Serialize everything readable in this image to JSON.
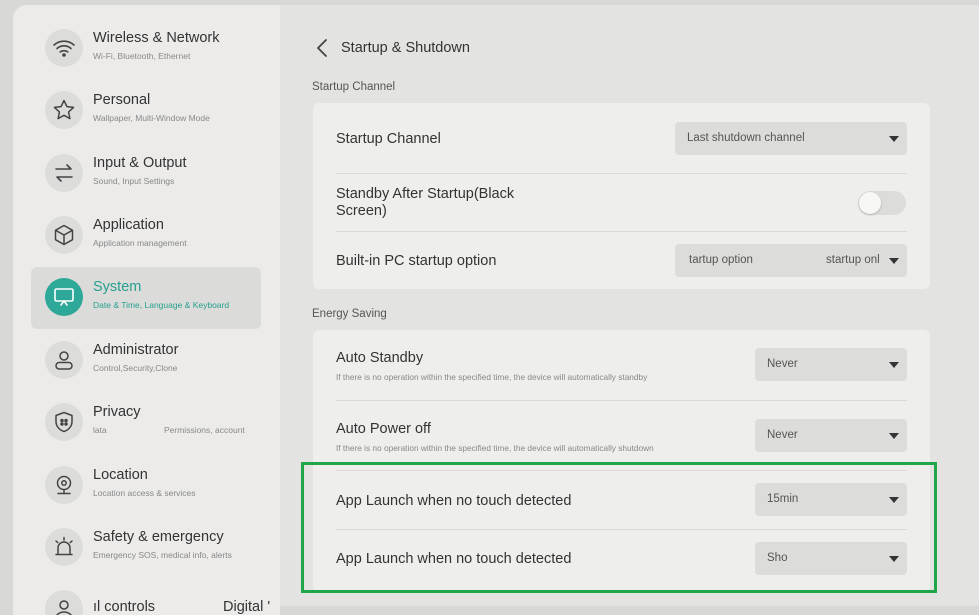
{
  "sidebar": {
    "items": [
      {
        "title": "Wireless & Network",
        "subtitle": "Wi-Fi, Bluetooth, Ethernet",
        "icon": "wifi-icon"
      },
      {
        "title": "Personal",
        "subtitle": "Wallpaper, Multi-Window Mode",
        "icon": "star-icon"
      },
      {
        "title": "Input & Output",
        "subtitle": "Sound, Input Settings",
        "icon": "arrows-icon"
      },
      {
        "title": "Application",
        "subtitle": "Application management",
        "icon": "cube-icon"
      },
      {
        "title": "System",
        "subtitle": "Date & Time, Language & Keyboard",
        "icon": "monitor-icon",
        "active": true
      },
      {
        "title": "Administrator",
        "subtitle": "Control,Security,Clone",
        "icon": "user-icon"
      },
      {
        "title": "Privacy",
        "subtitle": "lata",
        "subtitle_right": "Permissions, account",
        "icon": "shield-icon"
      },
      {
        "title": "Location",
        "subtitle": "Location access & services",
        "icon": "location-icon"
      },
      {
        "title": "Safety & emergency",
        "subtitle": "Emergency SOS, medical info, alerts",
        "icon": "alarm-icon"
      },
      {
        "title": "ıl controls",
        "title_right": "Digital '",
        "icon": "person-icon"
      }
    ]
  },
  "header": {
    "title": "Startup & Shutdown"
  },
  "sections": {
    "startup": {
      "label": "Startup Channel",
      "rows": {
        "channel": {
          "title": "Startup Channel",
          "value": "Last shutdown channel"
        },
        "standby": {
          "title": "Standby After Startup(Black Screen)",
          "toggle_on": false
        },
        "pc": {
          "title": "Built-in PC startup option",
          "value_left": "tartup option",
          "value_right": "startup onl"
        }
      }
    },
    "energy": {
      "label": "Energy Saving",
      "rows": {
        "auto_standby": {
          "title": "Auto Standby",
          "desc": "If there is no operation within the specified time, the device will automatically standby",
          "value": "Never"
        },
        "auto_power": {
          "title": "Auto Power off",
          "desc": "If there is no operation within the specified time, the device will automatically shutdown",
          "value": "Never"
        },
        "app_launch_1": {
          "title": "App Launch when no touch detected",
          "value": "15min"
        },
        "app_launch_2": {
          "title": "App Launch when no touch detected",
          "value": "Sho"
        }
      }
    }
  },
  "colors": {
    "accent": "#2ea898",
    "highlight": "#1fa64a"
  }
}
